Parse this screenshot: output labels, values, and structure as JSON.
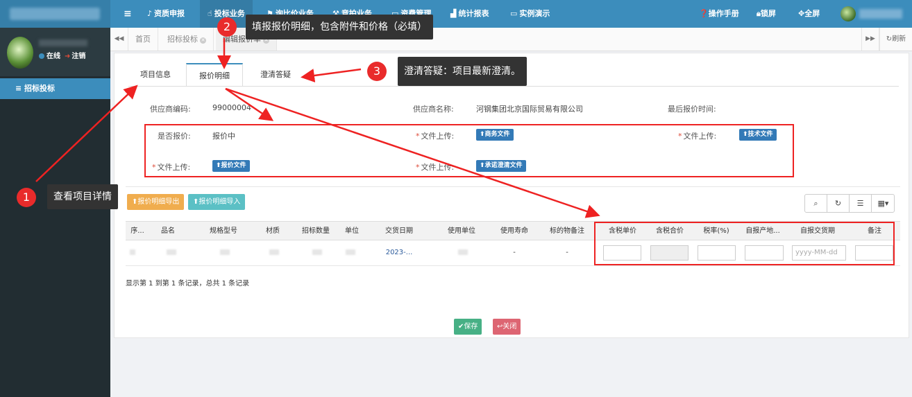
{
  "topbar": {
    "menu_icon": "hamburger-icon",
    "nav": [
      {
        "label": "资质申报",
        "icon": "bell-icon",
        "active": false
      },
      {
        "label": "投标业务",
        "icon": "hand-pointer-icon",
        "active": true
      },
      {
        "label": "询比价业务",
        "icon": "tag-icon",
        "active": false
      },
      {
        "label": "竞拍业务",
        "icon": "gavel-icon",
        "active": false
      },
      {
        "label": "资费管理",
        "icon": "credit-card-icon",
        "active": false
      },
      {
        "label": "统计报表",
        "icon": "bar-chart-icon",
        "active": false
      },
      {
        "label": "实例演示",
        "icon": "desktop-icon",
        "active": false
      }
    ],
    "right": {
      "manual": "操作手册",
      "lock": "锁屏",
      "fullscreen": "全屏"
    },
    "color": "#3c8dbc"
  },
  "sidebar": {
    "status_online": "在线",
    "logout": "注销",
    "menu_item": "招标投标",
    "bg_color": "#222d32"
  },
  "tabs_bar": {
    "tabs": [
      {
        "label": "首页",
        "closable": false,
        "active": false
      },
      {
        "label": "招标投标",
        "closable": true,
        "active": false
      },
      {
        "label": "编辑报价单",
        "closable": true,
        "active": true
      }
    ],
    "refresh": "刷新"
  },
  "form": {
    "tabs": [
      "项目信息",
      "报价明细",
      "澄清答疑"
    ],
    "active_tab": "报价明细",
    "supplier_code_label": "供应商编码:",
    "supplier_code_value": "99000004",
    "supplier_name_label": "供应商名称:",
    "supplier_name_value": "河钢集团北京国际贸易有限公司",
    "last_quote_time_label": "最后报价时间:",
    "is_quoting_label": "是否报价:",
    "is_quoting_value": "报价中",
    "file_upload_label": "文件上传:",
    "btn_business_file": "商务文件",
    "btn_technical_file": "技术文件",
    "btn_quote_file": "报价文件",
    "btn_clarification_file": "承诺澄清文件"
  },
  "table": {
    "btn_export": "报价明细导出",
    "btn_import": "报价明细导入",
    "toolbar_icons": [
      "search-icon",
      "refresh-icon",
      "list-icon",
      "columns-icon"
    ],
    "columns": [
      "序...",
      "品名",
      "规格型号",
      "材质",
      "招标数量",
      "单位",
      "交货日期",
      "使用单位",
      "使用寿命",
      "标的物备注",
      "含税单价",
      "含税合价",
      "税率(%)",
      "自报产地...",
      "自报交货期",
      "备注"
    ],
    "row": {
      "delivery_date": "2023-...",
      "service_life": "-",
      "subject_note": "-",
      "self_delivery_placeholder": "yyyy-MM-dd"
    },
    "pagination": "显示第 1 到第 1 条记录，总共 1 条记录"
  },
  "actions": {
    "save": "保存",
    "close": "关闭"
  },
  "annotations": [
    {
      "number": "1",
      "text": "查看项目详情"
    },
    {
      "number": "2",
      "text": "填报报价明细，包含附件和价格（必填）"
    },
    {
      "number": "3",
      "text": "澄清答疑：项目最新澄清。"
    }
  ]
}
